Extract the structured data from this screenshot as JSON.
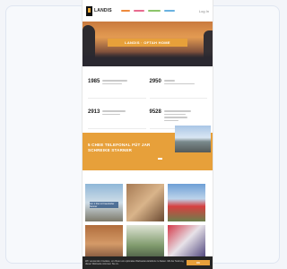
{
  "header": {
    "logo_text": "LANDIS",
    "nav_colors": [
      "#ee8a3c",
      "#e86b8f",
      "#8cc46a",
      "#69b2e0"
    ],
    "login": "Log In"
  },
  "hero": {
    "band_text": "LANDIS · OFTAH HOME"
  },
  "stats": [
    {
      "value": "1985"
    },
    {
      "value": "2950"
    },
    {
      "value": "2913"
    },
    {
      "value": "9528"
    }
  ],
  "promo": {
    "text": "5 CHEE TELEFONAL FÜT JAR SCHREIKE STARNER"
  },
  "gallery": {
    "tile_caption": "Am 1 Flut in Fraunhofer Sonner"
  },
  "cookie": {
    "text": "Wir verwenden Cookies, um Ihnen ein optimales Webseiten-Erlebnis zu bieten. Mit der Nutzung dieser Webseite stimmen Sie zu.",
    "button": "OK"
  },
  "colors": {
    "accent": "#e7a03a",
    "dark": "#242424"
  }
}
